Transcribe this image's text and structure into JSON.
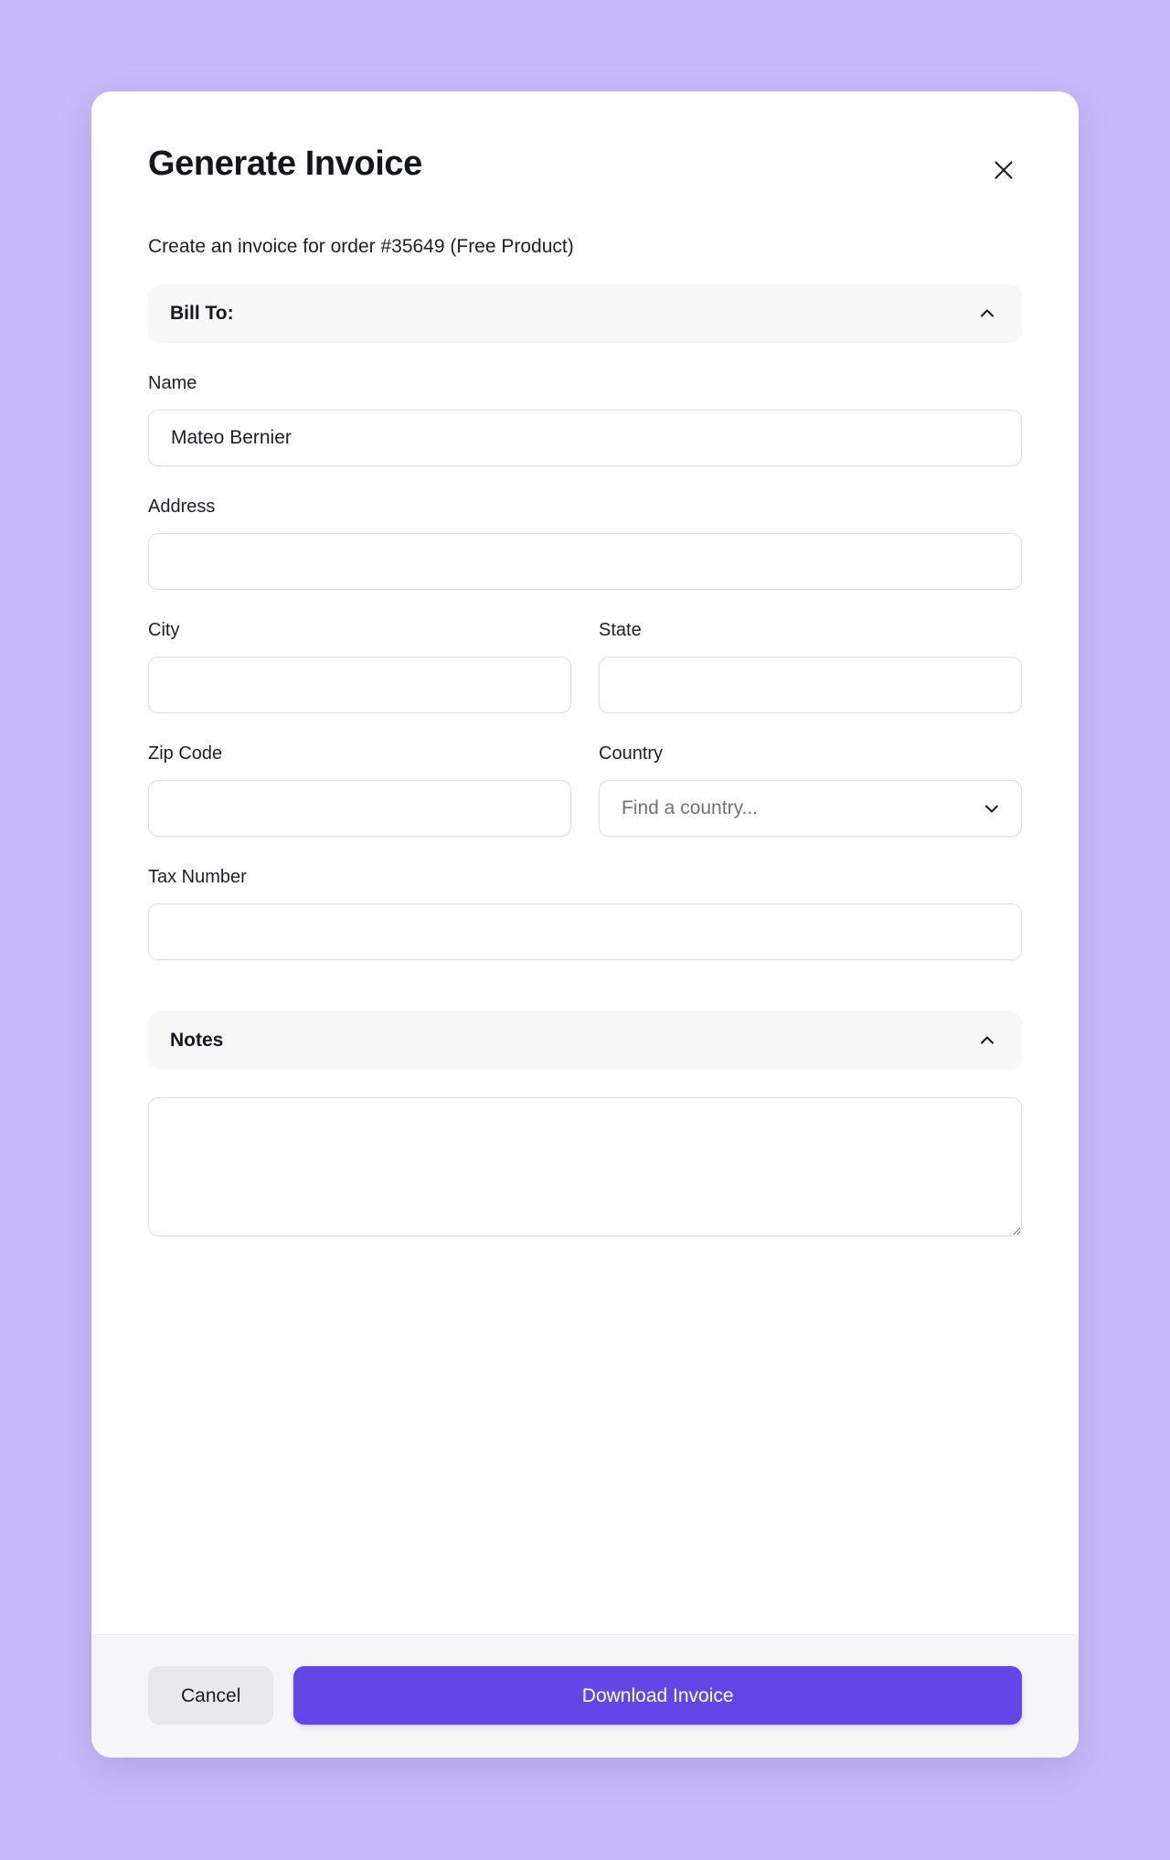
{
  "theme": {
    "backdrop_color": "#c6b9f8",
    "modal_bg": "#ffffff",
    "accent_color": "#6247e6",
    "section_header_bg": "#f7f7f8",
    "footer_bg": "#f6f6f8",
    "cancel_bg": "#e9e9ed",
    "input_border": "#dedfe3"
  },
  "modal": {
    "title": "Generate Invoice",
    "close_label": "Close",
    "subtitle": "Create an invoice for order #35649 (Free Product)"
  },
  "bill_to_section": {
    "label": "Bill To:",
    "expanded": true,
    "toggle_icon": "chevron-up-icon",
    "fields": {
      "name": {
        "label": "Name",
        "value": "Mateo Bernier",
        "placeholder": ""
      },
      "address": {
        "label": "Address",
        "value": "",
        "placeholder": ""
      },
      "city": {
        "label": "City",
        "value": "",
        "placeholder": ""
      },
      "state": {
        "label": "State",
        "value": "",
        "placeholder": ""
      },
      "zip_code": {
        "label": "Zip Code",
        "value": "",
        "placeholder": ""
      },
      "country": {
        "label": "Country",
        "value": "",
        "placeholder": "Find a country...",
        "toggle_icon": "chevron-down-icon"
      },
      "tax_number": {
        "label": "Tax Number",
        "value": "",
        "placeholder": ""
      }
    }
  },
  "notes_section": {
    "label": "Notes",
    "expanded": true,
    "toggle_icon": "chevron-up-icon",
    "textarea": {
      "value": "",
      "placeholder": ""
    }
  },
  "footer": {
    "cancel_label": "Cancel",
    "download_label": "Download Invoice"
  }
}
